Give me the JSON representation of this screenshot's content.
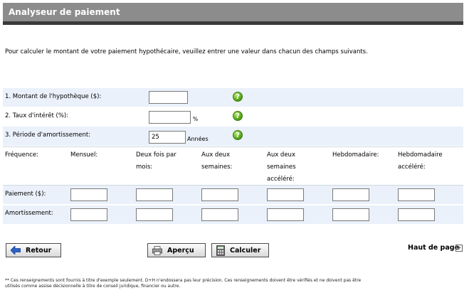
{
  "header": {
    "title": "Analyseur de paiement"
  },
  "intro": "Pour calculer le montant de votre paiement hypothécaire, veuillez entrer une valeur dans chacun des champs suivants.",
  "fields": {
    "mortgage_amount": {
      "label": "1. Montant de l'hypothèque ($):",
      "value": ""
    },
    "interest_rate": {
      "label": "2. Taux d'intérêt (%):",
      "value": "",
      "unit": "%"
    },
    "amortization": {
      "label": "3. Période d'amortissement:",
      "value": "25",
      "unit": "Années"
    }
  },
  "frequency": {
    "label": "Fréquence:",
    "columns": [
      "Mensuel:",
      "Deux fois par mois:",
      "Aux deux semaines:",
      "Aux deux semaines accéléré:",
      "Hebdomadaire:",
      "Hebdomadaire accéléré:"
    ],
    "payment_label": "Paiement ($):",
    "amortization_label": "Amortissement:"
  },
  "buttons": {
    "back": "Retour",
    "preview": "Aperçu",
    "calculate": "Calculer"
  },
  "top_link": "Haut de page",
  "footnote": "** Ces renseignements sont fournis à titre d'exemple seulement. D+H n'endossera pas leur précision. Ces renseignements doivent être vérifiés et ne doivent pas être utilisés comme assise décisionnelle à titre de conseil juridique, financier ou autre.",
  "colors": {
    "header_bg": "#8c8c8c",
    "header_bar": "#3a3a3a",
    "row_shade": "#eaf1fa",
    "help_green": "#4a9c12"
  },
  "icons": {
    "help": "help-icon",
    "back": "back-arrow-icon",
    "preview": "printer-icon",
    "calculate": "calculator-icon",
    "top": "plus-box-icon"
  }
}
